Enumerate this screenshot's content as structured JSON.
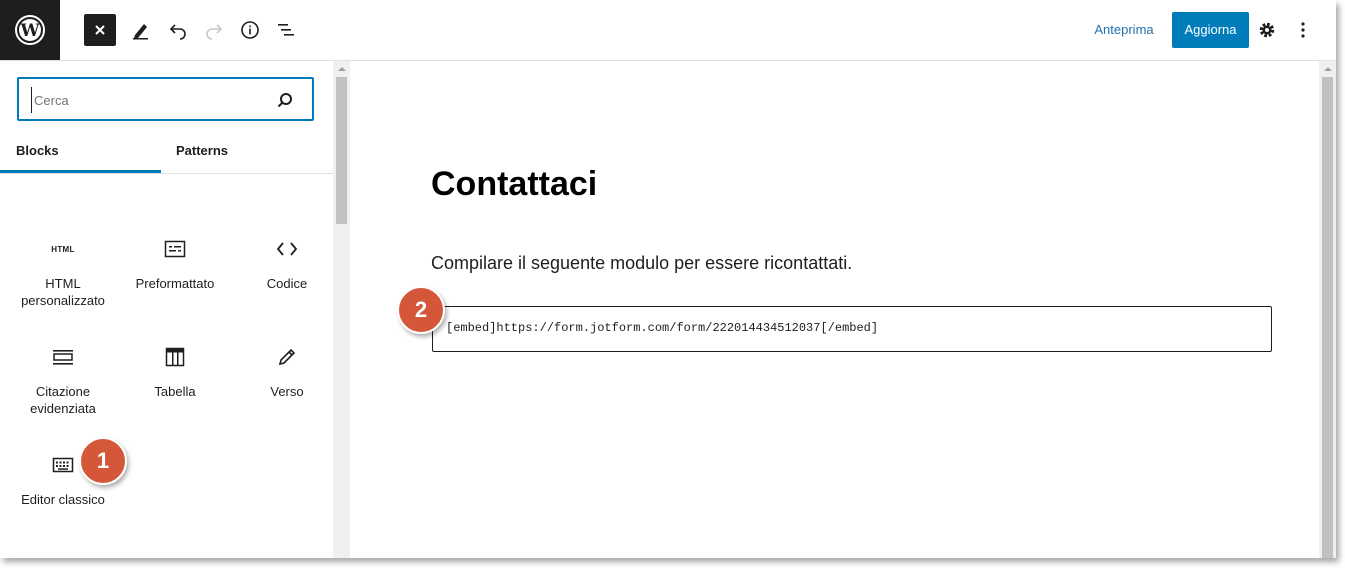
{
  "toolbar": {
    "preview_label": "Anteprima",
    "update_label": "Aggiorna",
    "accent_color": "#007cba"
  },
  "inserter": {
    "search_placeholder": "Cerca",
    "tabs": [
      "Blocks",
      "Patterns"
    ],
    "active_tab": "Blocks",
    "blocks": [
      {
        "label": "HTML personalizzato",
        "icon": "html-icon",
        "icon_text": "HTML"
      },
      {
        "label": "Preformattato",
        "icon": "preformatted-icon"
      },
      {
        "label": "Codice",
        "icon": "code-icon"
      },
      {
        "label": "Citazione evidenziata",
        "icon": "pullquote-icon"
      },
      {
        "label": "Tabella",
        "icon": "table-icon"
      },
      {
        "label": "Verso",
        "icon": "verse-icon"
      },
      {
        "label": "Editor classico",
        "icon": "keyboard-icon"
      }
    ]
  },
  "editor": {
    "title": "Contattaci",
    "paragraph": "Compilare il seguente modulo per essere ricontattati.",
    "shortcode": "[embed]https://form.jotform.com/form/222014434512037[/embed]"
  },
  "callouts": [
    "1",
    "2"
  ]
}
